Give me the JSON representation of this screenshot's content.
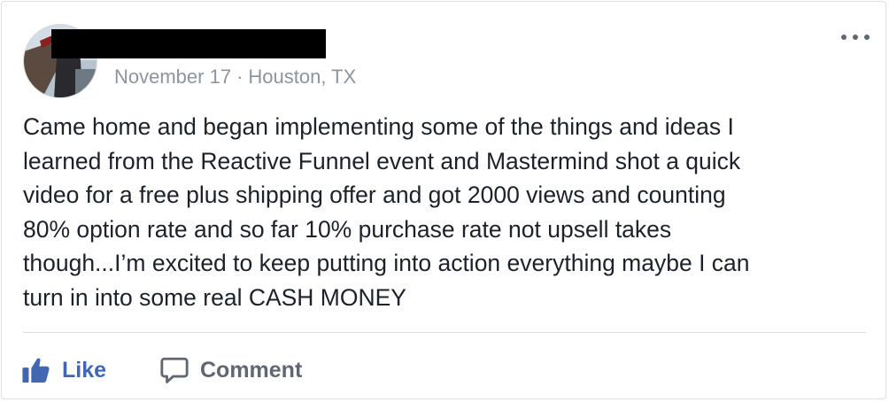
{
  "post": {
    "author_name": "",
    "date": "November 17",
    "separator": "·",
    "location": "Houston, TX",
    "menu_icon": "more-options-icon",
    "text": "Came home and began implementing some of the things and ideas I\nlearned from the Reactive Funnel event and Mastermind shot a quick\nvideo for a free plus shipping offer and got 2000 views and counting\n80% option rate and so far 10% purchase rate not upsell takes\nthough...I’m excited to keep putting into action everything maybe I can\nturn in into some real CASH MONEY"
  },
  "actions": {
    "like_label": "Like",
    "like_icon": "thumbs-up-icon",
    "comment_label": "Comment",
    "comment_icon": "speech-bubble-icon"
  },
  "colors": {
    "like_blue": "#4267b2",
    "meta_gray": "#8d949e",
    "action_gray": "#606770",
    "text": "#1d2129",
    "divider": "#dadde1"
  }
}
